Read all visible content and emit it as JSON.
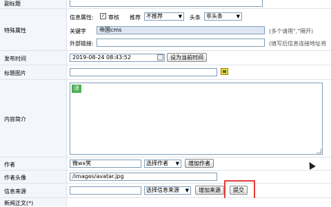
{
  "subtitle": {
    "label": "副标题"
  },
  "special": {
    "label": "特殊属性",
    "attr_label": "信息属性:",
    "audit_label": "审核",
    "recommend_label": "推荐",
    "recommend_value": "不推荐",
    "headline_label": "头条",
    "headline_value": "非头条",
    "keyword_label": "关键字",
    "keyword_value": "帝国cms",
    "keyword_hint": "(多个请用\",\"隔开)",
    "external_label": "外部链接:",
    "external_hint": "(填写后信息连接地址将"
  },
  "publish": {
    "label": "发布时间",
    "value": "2019-08-24 08:43:52",
    "set_now_button": "设为当前时间"
  },
  "title_image": {
    "label": "标题图片"
  },
  "summary": {
    "label": "内容简介",
    "editor_badge": "译"
  },
  "author": {
    "label": "作者",
    "value": "微wx笑",
    "select_label": "选择作者",
    "add_button": "增加作者"
  },
  "avatar": {
    "label": "作者头像",
    "value": "/images/avatar.jpg"
  },
  "source": {
    "label": "信息来源",
    "select_label": "选择信息来源",
    "add_button": "增加来源",
    "submit_button": "提交"
  },
  "newstext": {
    "label": "新闻正文(*)"
  },
  "colors": {
    "highlight_box": "#e53935",
    "label_bg": "#f3f7fb",
    "border": "#7f9db9",
    "badge": "#4caf50"
  }
}
